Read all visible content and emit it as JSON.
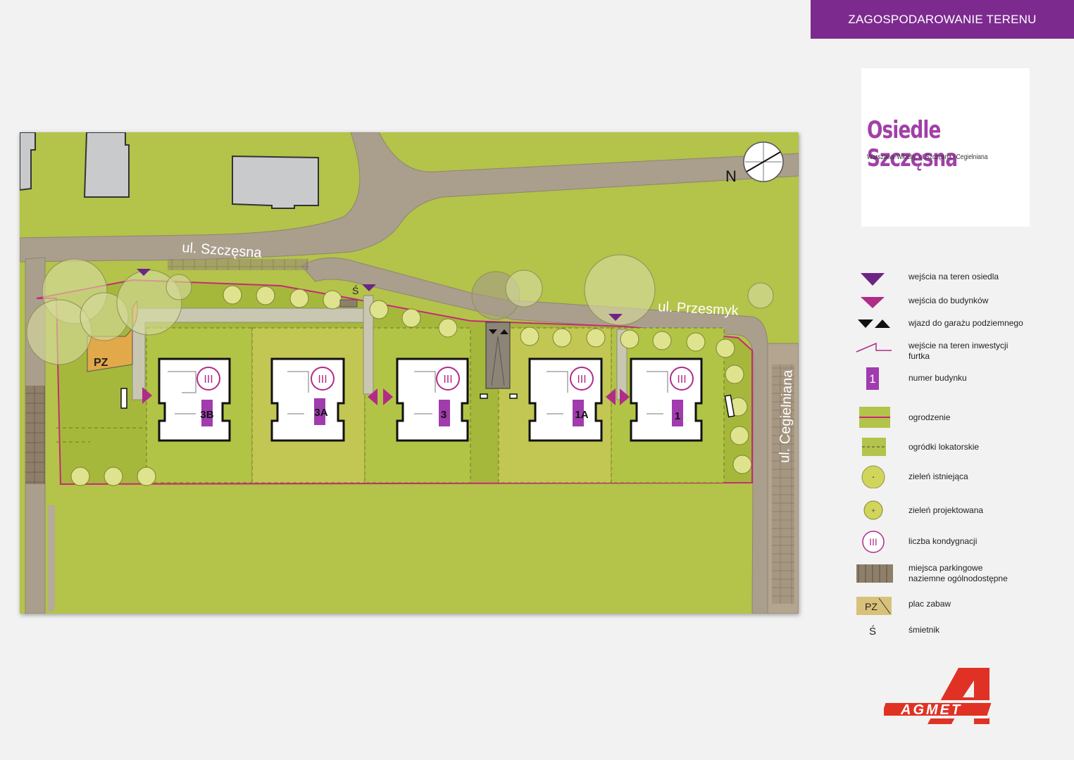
{
  "header": {
    "title": "ZAGOSPODAROWANIE TERENU"
  },
  "title_card": {
    "name": "Osiedle Szczęsna",
    "address": "Warszawa-Włochy, ul.Szczęsna i Cegielniana"
  },
  "map": {
    "streets": {
      "north": "ul. Szczęsna",
      "east_top": "ul. Przesmyk",
      "east": "ul. Cegielniana"
    },
    "north_label": "N",
    "playground_label": "PZ",
    "trash_label": "Ś",
    "buildings": [
      {
        "number": "3B",
        "floors": "III"
      },
      {
        "number": "3A",
        "floors": "III"
      },
      {
        "number": "3",
        "floors": "III"
      },
      {
        "number": "1A",
        "floors": "III"
      },
      {
        "number": "1",
        "floors": "III"
      }
    ]
  },
  "legend": {
    "items": [
      {
        "label": "wejścia na teren osiedla"
      },
      {
        "label": "wejścia do budynków"
      },
      {
        "label": "wjazd do garażu podziemnego"
      },
      {
        "label": "wejście na teren inwestycji",
        "label2": "furtka"
      },
      {
        "label": "numer budynku",
        "symbol_text": "1"
      },
      {
        "label": "ogrodzenie"
      },
      {
        "label": "ogródki lokatorskie"
      },
      {
        "label": "zieleń istniejąca"
      },
      {
        "label": "zieleń projektowana"
      },
      {
        "label": "liczba kondygnacji",
        "symbol_text": "III"
      },
      {
        "label": "miejsca parkingowe",
        "label2": "naziemne ogólnodostępne"
      },
      {
        "label": "plac zabaw",
        "symbol_text": "PZ"
      },
      {
        "label": "śmietnik",
        "symbol_text": "Ś"
      }
    ]
  },
  "logo": {
    "text": "AGMET",
    "mark": "A"
  },
  "colors": {
    "accent": "#7d2a8f",
    "title": "#a040a8",
    "grass": "#b4c34a",
    "road": "#aa9f8c",
    "fence": "#c8287a",
    "building_marker": "#a03cae"
  }
}
